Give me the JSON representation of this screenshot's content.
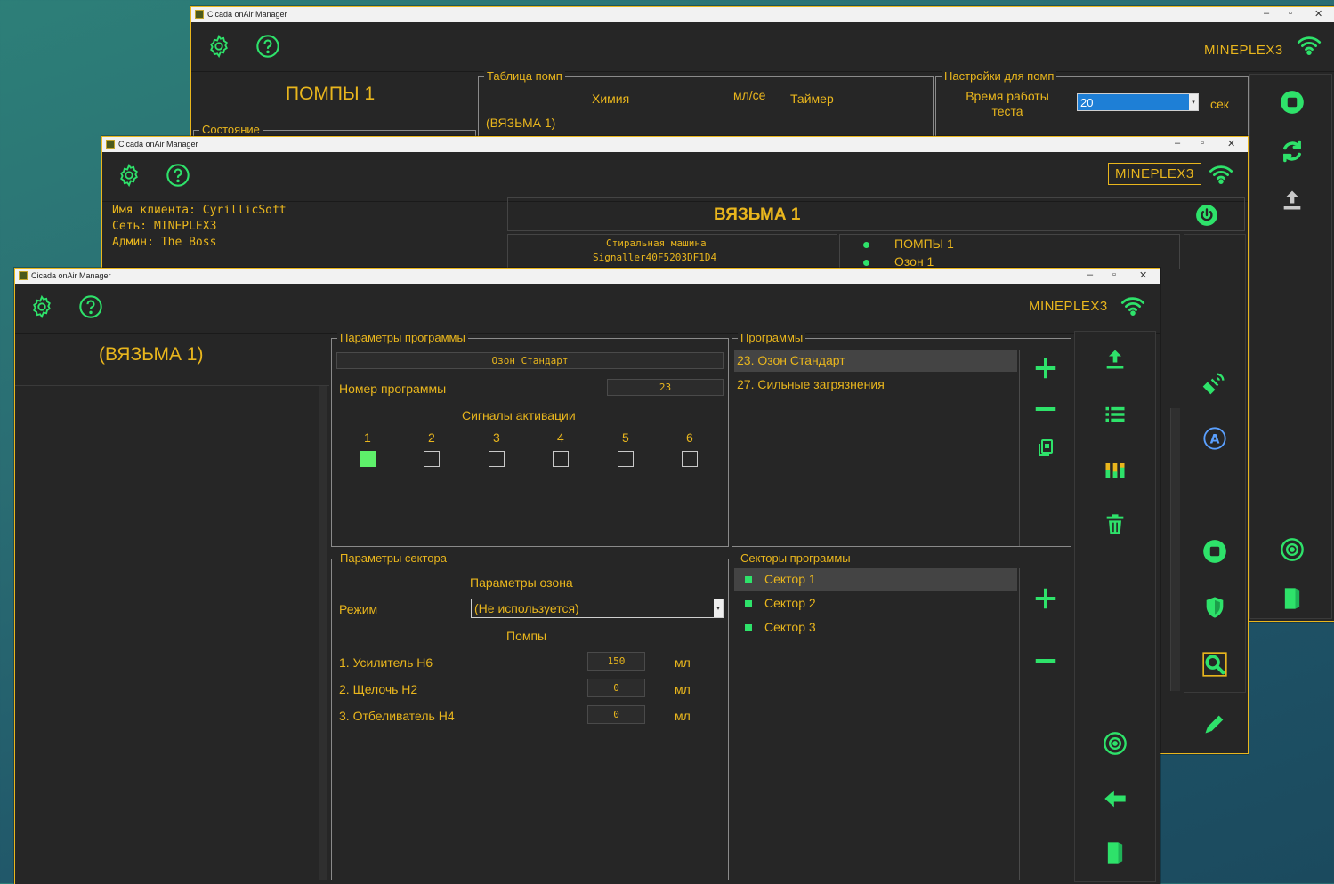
{
  "colors": {
    "accent": "#e9b61d",
    "green": "#2ee26a",
    "panel": "#262626"
  },
  "back_window": {
    "title": "Cicada onAir Manager",
    "network": "MINEPLEX3",
    "header": "ПОМПЫ 1",
    "state_label": "Состояние",
    "pump_table": {
      "title": "Таблица помп",
      "col_chem": "Химия",
      "col_ml": "мл/се",
      "col_timer": "Таймер",
      "row1": "(ВЯЗЬМА 1)"
    },
    "pump_settings": {
      "title": "Настройки для помп",
      "test_time_label": "Время работы теста",
      "test_time_value": "20",
      "unit": "сек"
    },
    "sidebar_icons": [
      "stop-icon",
      "refresh-icon",
      "upload-icon"
    ]
  },
  "mid_window": {
    "title": "Cicada onAir Manager",
    "network": "MINEPLEX3",
    "client_line": "Имя клиента: CyrillicSoft",
    "network_line": "Сеть: MINEPLEX3",
    "admin_line": "Админ: The Boss",
    "device_header": "ВЯЗЬМА 1",
    "machine_type": "Стиральная машина",
    "machine_id": "Signaller40F5203DF1D4",
    "items": [
      "ПОМПЫ 1",
      "Озон 1"
    ]
  },
  "front_window": {
    "title": "Cicada onAir Manager",
    "network": "MINEPLEX3",
    "left_title": "(ВЯЗЬМА 1)",
    "program_params": {
      "title": "Параметры программы",
      "name": "Озон Стандарт",
      "number_label": "Номер программы",
      "number_value": "23",
      "signals_title": "Сигналы активации",
      "signals": [
        {
          "label": "1",
          "on": true
        },
        {
          "label": "2",
          "on": false
        },
        {
          "label": "3",
          "on": false
        },
        {
          "label": "4",
          "on": false
        },
        {
          "label": "5",
          "on": false
        },
        {
          "label": "6",
          "on": false
        }
      ]
    },
    "programs": {
      "title": "Программы",
      "items": [
        "23. Озон Стандарт",
        "27. Сильные загрязнения"
      ]
    },
    "sector_params": {
      "title": "Параметры сектора",
      "ozone_title": "Параметры озона",
      "mode_label": "Режим",
      "mode_value": "(Не используется)",
      "pumps_title": "Помпы",
      "pumps": [
        {
          "name": "1. Усилитель H6",
          "value": "150",
          "unit": "мл"
        },
        {
          "name": "2. Щелочь H2",
          "value": "0",
          "unit": "мл"
        },
        {
          "name": "3. Отбеливатель H4",
          "value": "0",
          "unit": "мл"
        }
      ]
    },
    "sectors": {
      "title": "Секторы программы",
      "items": [
        "Сектор 1",
        "Сектор 2",
        "Сектор 3"
      ]
    }
  }
}
